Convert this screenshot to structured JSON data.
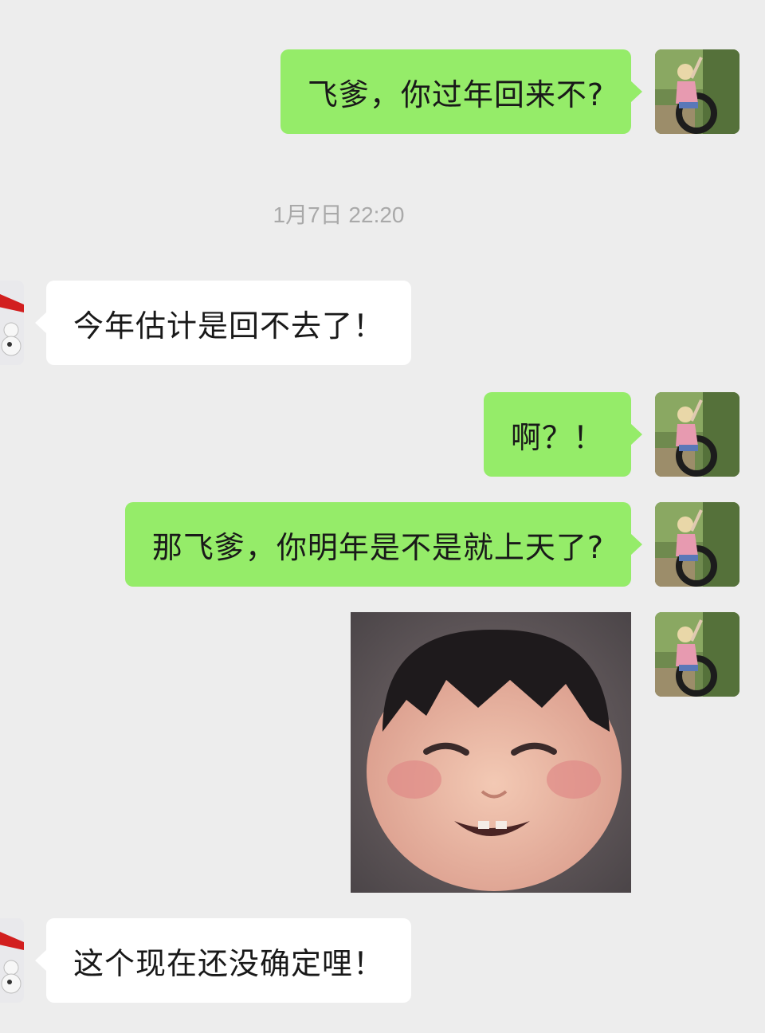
{
  "chat": {
    "messages": [
      {
        "sender": "self",
        "type": "text",
        "text": "飞爹，你过年回来不?"
      },
      {
        "type": "timestamp",
        "text": "1月7日 22:20"
      },
      {
        "sender": "other",
        "type": "text",
        "text": "今年估计是回不去了！"
      },
      {
        "sender": "self",
        "type": "text",
        "text": "啊？！"
      },
      {
        "sender": "self",
        "type": "text",
        "text": "那飞爹，你明年是不是就上天了?"
      },
      {
        "sender": "self",
        "type": "image",
        "icon": "smiling-baby-sticker"
      },
      {
        "sender": "other",
        "type": "text",
        "text": "这个现在还没确定哩！"
      }
    ]
  },
  "colors": {
    "background": "#ededed",
    "self_bubble": "#95ec69",
    "other_bubble": "#ffffff",
    "timestamp_text": "#a9a9a9"
  }
}
